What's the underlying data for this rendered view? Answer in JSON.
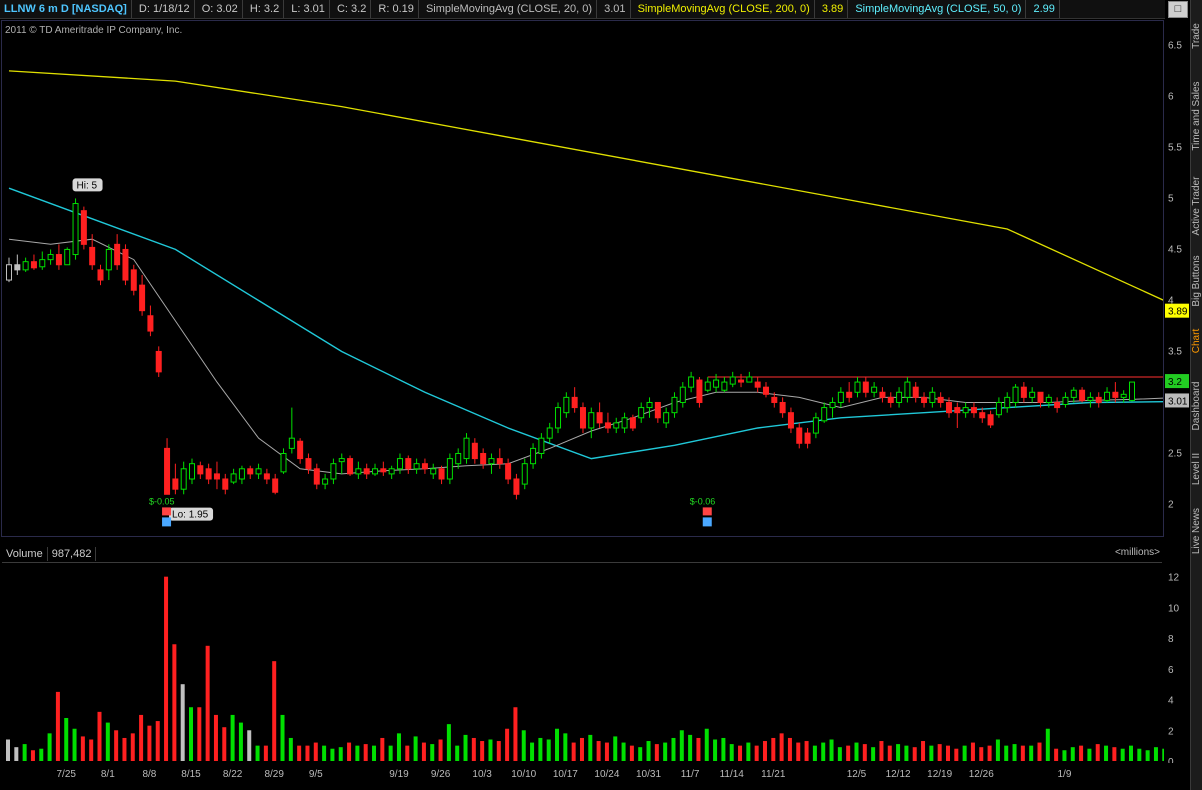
{
  "header": {
    "symbol": "LLNW 6 m D [NASDAQ]",
    "date": "D: 1/18/12",
    "open": "O: 3.02",
    "high": "H: 3.2",
    "low": "L: 3.01",
    "close": "C: 3.2",
    "range": "R: 0.19",
    "sma20_label": "SimpleMovingAvg (CLOSE, 20, 0)",
    "sma20_value": "3.01",
    "sma200_label": "SimpleMovingAvg (CLOSE, 200, 0)",
    "sma200_value": "3.89",
    "sma50_label": "SimpleMovingAvg (CLOSE, 50, 0)",
    "sma50_value": "2.99",
    "maximize_icon": "□"
  },
  "copyright": "2011 © TD Ameritrade IP Company, Inc.",
  "side_tabs": [
    "Trade",
    "Time and Sales",
    "Active Trader",
    "Big Buttons",
    "Chart",
    "Dashboard",
    "Level II",
    "Live News"
  ],
  "active_tab": "Chart",
  "volume_header": {
    "label": "Volume",
    "value": "987,482",
    "unit": "<millions>"
  },
  "colors": {
    "up": "#00e000",
    "down": "#ff2020",
    "neutral": "#c0c0c0",
    "sma20": "#a8a8a8",
    "sma200": "#e0e000",
    "sma50": "#20c8d8",
    "resistance": "#ff3030"
  },
  "chart_data": [
    {
      "type": "candlestick",
      "title": "LLNW 6 m D [NASDAQ]",
      "ylim": [
        1.75,
        6.7
      ],
      "yticks": [
        "6.5",
        "6",
        "5.5",
        "5",
        "4.5",
        "4",
        "3.5",
        "3",
        "2.5",
        "2"
      ],
      "x_tick_labels": [
        "7/25",
        "8/1",
        "8/8",
        "8/15",
        "8/22",
        "8/29",
        "9/5",
        "9/19",
        "9/26",
        "10/3",
        "10/10",
        "10/17",
        "10/24",
        "10/31",
        "11/7",
        "11/14",
        "11/21",
        "12/5",
        "12/12",
        "12/19",
        "12/26",
        "1/9"
      ],
      "bars": [
        [
          4.18,
          4.42,
          4.2,
          4.35
        ],
        [
          4.25,
          4.45,
          4.35,
          4.3
        ],
        [
          4.28,
          4.42,
          4.3,
          4.38
        ],
        [
          4.3,
          4.45,
          4.38,
          4.32
        ],
        [
          4.3,
          4.48,
          4.33,
          4.4
        ],
        [
          4.35,
          4.5,
          4.4,
          4.45
        ],
        [
          4.3,
          4.55,
          4.45,
          4.35
        ],
        [
          4.35,
          4.52,
          4.35,
          4.5
        ],
        [
          4.4,
          5.0,
          4.45,
          4.95
        ],
        [
          4.5,
          4.92,
          4.88,
          4.55
        ],
        [
          4.3,
          4.65,
          4.52,
          4.35
        ],
        [
          4.15,
          4.35,
          4.3,
          4.2
        ],
        [
          4.2,
          4.55,
          4.3,
          4.5
        ],
        [
          4.3,
          4.65,
          4.55,
          4.35
        ],
        [
          4.15,
          4.55,
          4.5,
          4.2
        ],
        [
          4.05,
          4.35,
          4.3,
          4.1
        ],
        [
          3.85,
          4.25,
          4.15,
          3.9
        ],
        [
          3.65,
          3.95,
          3.85,
          3.7
        ],
        [
          3.25,
          3.55,
          3.5,
          3.3
        ],
        [
          2.1,
          2.65,
          2.55,
          2.1
        ],
        [
          2.1,
          2.4,
          2.25,
          2.15
        ],
        [
          2.1,
          2.42,
          2.15,
          2.35
        ],
        [
          2.2,
          2.45,
          2.25,
          2.4
        ],
        [
          2.25,
          2.42,
          2.38,
          2.3
        ],
        [
          2.2,
          2.4,
          2.35,
          2.25
        ],
        [
          2.15,
          2.42,
          2.3,
          2.25
        ],
        [
          2.1,
          2.3,
          2.25,
          2.15
        ],
        [
          2.2,
          2.35,
          2.22,
          2.3
        ],
        [
          2.2,
          2.38,
          2.25,
          2.35
        ],
        [
          2.25,
          2.38,
          2.35,
          2.3
        ],
        [
          2.25,
          2.4,
          2.3,
          2.35
        ],
        [
          2.2,
          2.35,
          2.3,
          2.25
        ],
        [
          2.1,
          2.3,
          2.25,
          2.12
        ],
        [
          2.3,
          2.55,
          2.32,
          2.5
        ],
        [
          2.5,
          2.95,
          2.55,
          2.65
        ],
        [
          2.4,
          2.65,
          2.62,
          2.45
        ],
        [
          2.3,
          2.5,
          2.45,
          2.35
        ],
        [
          2.15,
          2.4,
          2.35,
          2.2
        ],
        [
          2.15,
          2.3,
          2.2,
          2.25
        ],
        [
          2.2,
          2.45,
          2.25,
          2.4
        ],
        [
          2.3,
          2.5,
          2.42,
          2.45
        ],
        [
          2.28,
          2.48,
          2.45,
          2.3
        ],
        [
          2.25,
          2.42,
          2.3,
          2.35
        ],
        [
          2.25,
          2.4,
          2.35,
          2.3
        ],
        [
          2.28,
          2.4,
          2.3,
          2.35
        ],
        [
          2.28,
          2.42,
          2.35,
          2.32
        ],
        [
          2.25,
          2.38,
          2.3,
          2.35
        ],
        [
          2.3,
          2.5,
          2.35,
          2.45
        ],
        [
          2.3,
          2.48,
          2.45,
          2.35
        ],
        [
          2.3,
          2.45,
          2.35,
          2.4
        ],
        [
          2.3,
          2.45,
          2.4,
          2.35
        ],
        [
          2.25,
          2.4,
          2.3,
          2.35
        ],
        [
          2.2,
          2.38,
          2.35,
          2.25
        ],
        [
          2.2,
          2.5,
          2.25,
          2.45
        ],
        [
          2.35,
          2.55,
          2.4,
          2.5
        ],
        [
          2.4,
          2.7,
          2.45,
          2.65
        ],
        [
          2.4,
          2.65,
          2.6,
          2.45
        ],
        [
          2.35,
          2.55,
          2.5,
          2.4
        ],
        [
          2.3,
          2.5,
          2.4,
          2.45
        ],
        [
          2.35,
          2.55,
          2.45,
          2.4
        ],
        [
          2.2,
          2.45,
          2.4,
          2.25
        ],
        [
          2.05,
          2.3,
          2.25,
          2.1
        ],
        [
          2.15,
          2.45,
          2.2,
          2.4
        ],
        [
          2.35,
          2.6,
          2.4,
          2.55
        ],
        [
          2.45,
          2.7,
          2.5,
          2.65
        ],
        [
          2.6,
          2.8,
          2.65,
          2.75
        ],
        [
          2.7,
          3.0,
          2.75,
          2.95
        ],
        [
          2.85,
          3.1,
          2.9,
          3.05
        ],
        [
          2.9,
          3.15,
          3.05,
          2.95
        ],
        [
          2.7,
          3.0,
          2.95,
          2.75
        ],
        [
          2.65,
          2.95,
          2.75,
          2.9
        ],
        [
          2.75,
          3.0,
          2.9,
          2.8
        ],
        [
          2.7,
          2.9,
          2.8,
          2.75
        ],
        [
          2.7,
          2.85,
          2.75,
          2.8
        ],
        [
          2.7,
          2.9,
          2.75,
          2.85
        ],
        [
          2.72,
          2.88,
          2.85,
          2.75
        ],
        [
          2.8,
          3.0,
          2.85,
          2.95
        ],
        [
          2.85,
          3.05,
          2.95,
          3.0
        ],
        [
          2.8,
          3.0,
          3.0,
          2.85
        ],
        [
          2.75,
          2.95,
          2.8,
          2.9
        ],
        [
          2.85,
          3.1,
          2.9,
          3.05
        ],
        [
          2.95,
          3.2,
          3.0,
          3.15
        ],
        [
          3.1,
          3.3,
          3.15,
          3.25
        ],
        [
          2.95,
          3.25,
          3.22,
          3.0
        ],
        [
          3.1,
          3.25,
          3.12,
          3.2
        ],
        [
          3.1,
          3.28,
          3.15,
          3.22
        ],
        [
          3.1,
          3.25,
          3.12,
          3.2
        ],
        [
          3.15,
          3.3,
          3.18,
          3.25
        ],
        [
          3.15,
          3.28,
          3.22,
          3.2
        ],
        [
          3.2,
          3.3,
          3.2,
          3.25
        ],
        [
          3.1,
          3.25,
          3.2,
          3.15
        ],
        [
          3.05,
          3.2,
          3.15,
          3.08
        ],
        [
          2.95,
          3.1,
          3.05,
          3.0
        ],
        [
          2.85,
          3.05,
          3.0,
          2.9
        ],
        [
          2.7,
          2.95,
          2.9,
          2.75
        ],
        [
          2.55,
          2.8,
          2.75,
          2.6
        ],
        [
          2.55,
          2.75,
          2.7,
          2.6
        ],
        [
          2.65,
          2.9,
          2.7,
          2.85
        ],
        [
          2.8,
          3.0,
          2.82,
          2.95
        ],
        [
          2.85,
          3.05,
          2.95,
          3.0
        ],
        [
          2.95,
          3.15,
          3.0,
          3.1
        ],
        [
          3.0,
          3.2,
          3.1,
          3.05
        ],
        [
          3.05,
          3.25,
          3.1,
          3.2
        ],
        [
          3.05,
          3.25,
          3.2,
          3.1
        ],
        [
          3.05,
          3.2,
          3.1,
          3.15
        ],
        [
          3.0,
          3.15,
          3.1,
          3.05
        ],
        [
          2.95,
          3.1,
          3.05,
          3.0
        ],
        [
          2.95,
          3.15,
          3.0,
          3.1
        ],
        [
          3.0,
          3.25,
          3.05,
          3.2
        ],
        [
          3.0,
          3.2,
          3.15,
          3.05
        ],
        [
          2.95,
          3.1,
          3.05,
          3.0
        ],
        [
          2.95,
          3.15,
          3.0,
          3.1
        ],
        [
          2.95,
          3.1,
          3.05,
          3.0
        ],
        [
          2.85,
          3.05,
          3.0,
          2.9
        ],
        [
          2.75,
          3.0,
          2.95,
          2.9
        ],
        [
          2.85,
          3.0,
          2.9,
          2.95
        ],
        [
          2.85,
          3.0,
          2.95,
          2.9
        ],
        [
          2.8,
          2.95,
          2.9,
          2.85
        ],
        [
          2.75,
          2.92,
          2.88,
          2.78
        ],
        [
          2.85,
          3.05,
          2.88,
          3.0
        ],
        [
          2.9,
          3.1,
          2.95,
          3.05
        ],
        [
          2.95,
          3.18,
          3.0,
          3.15
        ],
        [
          3.0,
          3.2,
          3.15,
          3.05
        ],
        [
          3.0,
          3.15,
          3.05,
          3.1
        ],
        [
          2.95,
          3.1,
          3.1,
          3.0
        ],
        [
          2.95,
          3.08,
          3.0,
          3.05
        ],
        [
          2.9,
          3.05,
          3.0,
          2.95
        ],
        [
          2.95,
          3.1,
          2.98,
          3.05
        ],
        [
          3.0,
          3.15,
          3.05,
          3.12
        ],
        [
          3.0,
          3.15,
          3.12,
          3.02
        ],
        [
          2.95,
          3.1,
          3.02,
          3.05
        ],
        [
          2.95,
          3.1,
          3.05,
          3.0
        ],
        [
          3.0,
          3.15,
          3.02,
          3.1
        ],
        [
          3.0,
          3.2,
          3.1,
          3.05
        ],
        [
          3.0,
          3.12,
          3.05,
          3.08
        ],
        [
          3.01,
          3.2,
          3.02,
          3.2
        ]
      ],
      "sma200": [
        [
          0,
          6.25
        ],
        [
          20,
          6.15
        ],
        [
          40,
          5.9
        ],
        [
          60,
          5.6
        ],
        [
          80,
          5.3
        ],
        [
          100,
          5.0
        ],
        [
          120,
          4.7
        ],
        [
          141,
          3.92
        ]
      ],
      "sma50": [
        [
          0,
          5.1
        ],
        [
          10,
          4.8
        ],
        [
          20,
          4.5
        ],
        [
          30,
          4.0
        ],
        [
          40,
          3.5
        ],
        [
          50,
          3.1
        ],
        [
          60,
          2.75
        ],
        [
          70,
          2.45
        ],
        [
          80,
          2.58
        ],
        [
          90,
          2.75
        ],
        [
          100,
          2.85
        ],
        [
          110,
          2.9
        ],
        [
          120,
          2.95
        ],
        [
          130,
          3.0
        ],
        [
          141,
          3.01
        ]
      ],
      "sma20": [
        [
          0,
          4.6
        ],
        [
          5,
          4.55
        ],
        [
          10,
          4.6
        ],
        [
          15,
          4.4
        ],
        [
          20,
          3.8
        ],
        [
          25,
          3.2
        ],
        [
          30,
          2.65
        ],
        [
          35,
          2.35
        ],
        [
          40,
          2.3
        ],
        [
          45,
          2.33
        ],
        [
          50,
          2.35
        ],
        [
          55,
          2.38
        ],
        [
          60,
          2.4
        ],
        [
          65,
          2.55
        ],
        [
          70,
          2.72
        ],
        [
          75,
          2.85
        ],
        [
          80,
          3.0
        ],
        [
          85,
          3.1
        ],
        [
          90,
          3.1
        ],
        [
          95,
          3.05
        ],
        [
          100,
          2.95
        ],
        [
          105,
          3.05
        ],
        [
          110,
          3.05
        ],
        [
          115,
          3.0
        ],
        [
          120,
          3.0
        ],
        [
          125,
          3.0
        ],
        [
          130,
          3.02
        ],
        [
          135,
          3.03
        ],
        [
          141,
          3.05
        ]
      ],
      "resistance_line": {
        "value": 3.25,
        "from": 84,
        "to": 141
      },
      "annotations": [
        {
          "text": "Hi: 5",
          "bar": 8,
          "price": 5.0
        },
        {
          "text": "Lo: 1.95",
          "bar": 19,
          "price": 1.95
        },
        {
          "text": "$-0.05",
          "bar": 19,
          "price": 2.05
        },
        {
          "text": "$-0.06",
          "bar": 84,
          "price": 2.05
        }
      ],
      "value_labels": [
        {
          "text": "3.89",
          "price": 3.89,
          "color": "#ffff00"
        },
        {
          "text": "3.2",
          "price": 3.2,
          "color": "#22cc22"
        },
        {
          "text": "3.01",
          "price": 3.01,
          "color": "#bbbbbb"
        }
      ]
    },
    {
      "type": "bar",
      "title": "Volume",
      "ylim": [
        0,
        12.5
      ],
      "yticks": [
        "12",
        "10",
        "8",
        "6",
        "4",
        "2",
        "0"
      ],
      "values": [
        1.4,
        0.9,
        1.1,
        0.7,
        0.8,
        1.8,
        4.5,
        2.8,
        2.1,
        1.6,
        1.4,
        3.2,
        2.5,
        2.0,
        1.5,
        1.8,
        3.0,
        2.3,
        2.6,
        12.0,
        7.6,
        5.0,
        3.5,
        3.5,
        7.5,
        3.0,
        2.2,
        3.0,
        2.5,
        2.0,
        1.0,
        1.0,
        6.5,
        3.0,
        1.5,
        1.0,
        1.0,
        1.2,
        1.0,
        0.8,
        0.9,
        1.2,
        1.0,
        1.1,
        1.0,
        1.5,
        1.0,
        1.8,
        1.0,
        1.6,
        1.2,
        1.1,
        1.4,
        2.4,
        1.0,
        1.7,
        1.5,
        1.3,
        1.4,
        1.3,
        2.1,
        3.5,
        2.0,
        1.2,
        1.5,
        1.4,
        2.1,
        1.8,
        1.2,
        1.5,
        1.7,
        1.3,
        1.2,
        1.6,
        1.2,
        1.0,
        0.9,
        1.3,
        1.1,
        1.2,
        1.5,
        2.0,
        1.7,
        1.5,
        2.1,
        1.4,
        1.5,
        1.1,
        1.0,
        1.2,
        1.0,
        1.3,
        1.5,
        1.8,
        1.5,
        1.2,
        1.3,
        1.0,
        1.2,
        1.4,
        0.9,
        1.0,
        1.2,
        1.1,
        0.9,
        1.3,
        1.0,
        1.1,
        1.0,
        0.9,
        1.3,
        1.0,
        1.1,
        1.0,
        0.8,
        1.0,
        1.2,
        0.9,
        1.0,
        1.4,
        1.0,
        1.1,
        1.0,
        1.0,
        1.2,
        2.1,
        0.8,
        0.7,
        0.9,
        1.0,
        0.8,
        1.1,
        1.0,
        0.9,
        0.8,
        1.0,
        0.8,
        0.7,
        0.9,
        0.8,
        1.0,
        1.1
      ]
    }
  ]
}
